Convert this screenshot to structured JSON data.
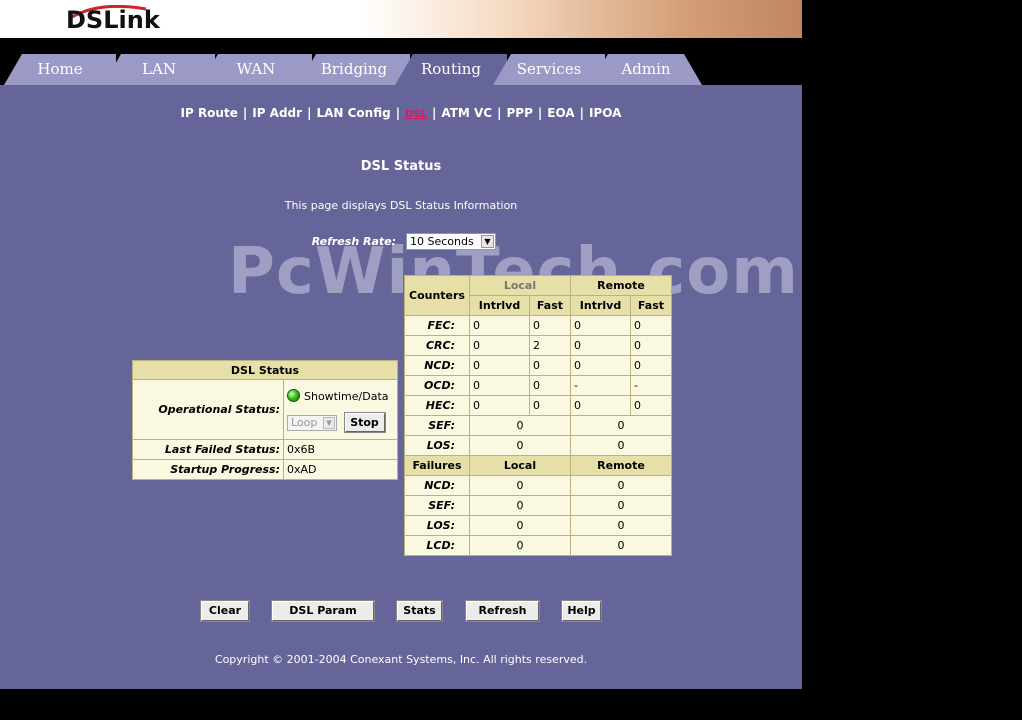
{
  "logo": {
    "text": "DSLink"
  },
  "tabs": [
    {
      "label": "Home"
    },
    {
      "label": "LAN"
    },
    {
      "label": "WAN"
    },
    {
      "label": "Bridging"
    },
    {
      "label": "Routing"
    },
    {
      "label": "Services"
    },
    {
      "label": "Admin"
    }
  ],
  "subnav": [
    {
      "label": "IP Route"
    },
    {
      "label": "IP Addr"
    },
    {
      "label": "LAN Config"
    },
    {
      "label": "DSL"
    },
    {
      "label": "ATM VC"
    },
    {
      "label": "PPP"
    },
    {
      "label": "EOA"
    },
    {
      "label": "IPOA"
    }
  ],
  "page": {
    "title": "DSL Status",
    "description": "This page displays DSL Status Information",
    "refresh_label": "Refresh Rate:",
    "refresh_value": "10 Seconds"
  },
  "watermark": "PcWinTech.com",
  "status": {
    "header": "DSL Status",
    "operational_label": "Operational Status:",
    "operational_value": "Showtime/Data",
    "loop_select": "Loop",
    "stop_button": "Stop",
    "last_failed_label": "Last Failed Status:",
    "last_failed_value": "0x6B",
    "startup_label": "Startup Progress:",
    "startup_value": "0xAD"
  },
  "counters": {
    "header": "Counters",
    "local": "Local",
    "remote": "Remote",
    "intrlvd": "Intrlvd",
    "fast": "Fast",
    "rows": [
      {
        "name": "FEC:",
        "v": [
          "0",
          "0",
          "0",
          "0"
        ]
      },
      {
        "name": "CRC:",
        "v": [
          "0",
          "2",
          "0",
          "0"
        ]
      },
      {
        "name": "NCD:",
        "v": [
          "0",
          "0",
          "0",
          "0"
        ]
      },
      {
        "name": "OCD:",
        "v": [
          "0",
          "0",
          "-",
          "-"
        ]
      },
      {
        "name": "HEC:",
        "v": [
          "0",
          "0",
          "0",
          "0"
        ]
      }
    ],
    "merged_rows": [
      {
        "name": "SEF:",
        "local": "0",
        "remote": "0"
      },
      {
        "name": "LOS:",
        "local": "0",
        "remote": "0"
      }
    ]
  },
  "failures": {
    "header": "Failures",
    "local": "Local",
    "remote": "Remote",
    "rows": [
      {
        "name": "NCD:",
        "local": "0",
        "remote": "0"
      },
      {
        "name": "SEF:",
        "local": "0",
        "remote": "0"
      },
      {
        "name": "LOS:",
        "local": "0",
        "remote": "0"
      },
      {
        "name": "LCD:",
        "local": "0",
        "remote": "0"
      }
    ]
  },
  "buttons": {
    "clear": "Clear",
    "dsl_param": "DSL Param",
    "stats": "Stats",
    "refresh": "Refresh",
    "help": "Help"
  },
  "copyright": "Copyright © 2001-2004 Conexant Systems, Inc. All rights reserved.",
  "colors": {
    "panel": "#66659A",
    "tab": "#9b9ac6",
    "tab_active": "#66659A",
    "table_bg": "#fbf8e2",
    "table_header": "#e6dfa8",
    "active_link": "#d81b60"
  }
}
